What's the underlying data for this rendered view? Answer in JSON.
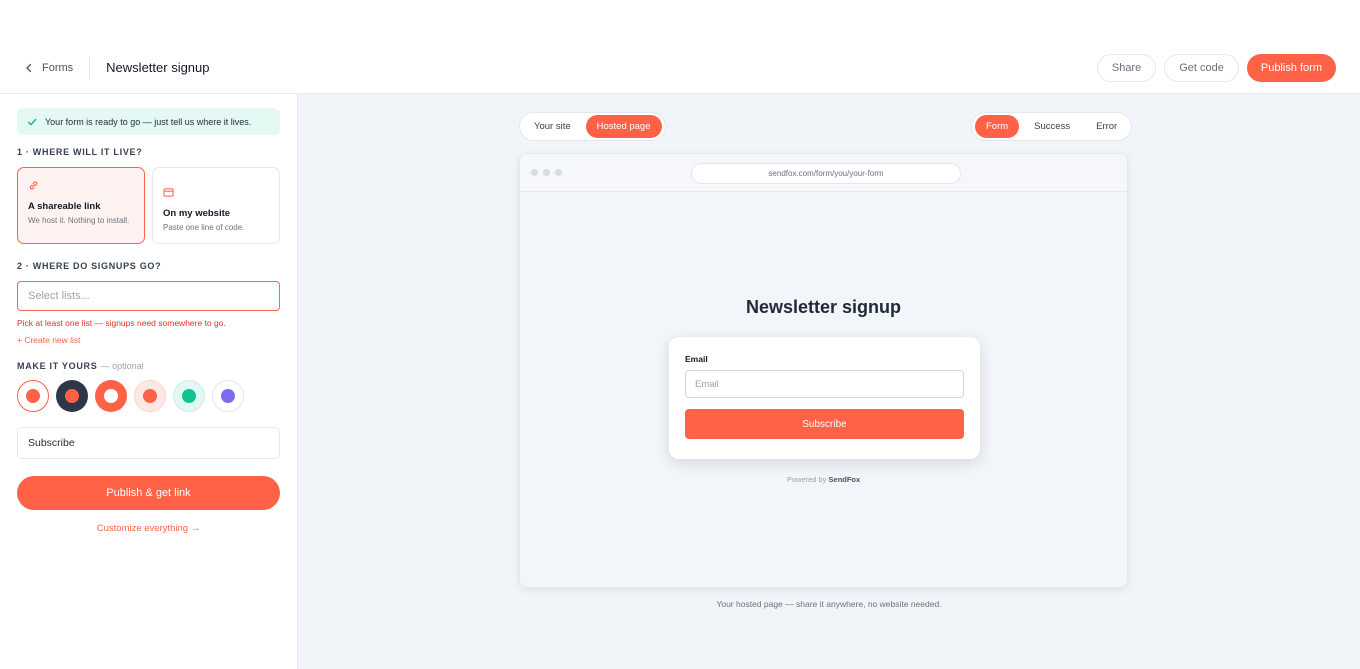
{
  "header": {
    "back_label": "Forms",
    "title": "Newsletter signup",
    "share_label": "Share",
    "get_code_label": "Get code",
    "publish_label": "Publish form"
  },
  "sidebar": {
    "notice": "Your form is ready to go — just tell us where it lives.",
    "section1": "1 · WHERE WILL IT LIVE?",
    "option_link": {
      "title": "A shareable link",
      "subtitle": "We host it. Nothing to install."
    },
    "option_website": {
      "title": "On my website",
      "subtitle": "Paste one line of code."
    },
    "section2": "2 · WHERE DO SIGNUPS GO?",
    "lists_placeholder": "Select lists...",
    "lists_error": "Pick at least one list — signups need somewhere to go.",
    "create_list": "+ Create new list",
    "section3": "MAKE IT YOURS",
    "section3_optional": "— optional",
    "button_text_value": "Subscribe",
    "publish_button": "Publish & get link",
    "customize_link": "Customize everything →"
  },
  "colors": {
    "accent": "#ff6247",
    "swatches": [
      {
        "name": "coral-outline",
        "bg": "#ffffff",
        "dot": "#ff6247",
        "selected": true
      },
      {
        "name": "dark",
        "bg": "#2d3748",
        "dot": "#ff6247"
      },
      {
        "name": "coral-solid",
        "bg": "#ff6247",
        "dot": "#ffffff"
      },
      {
        "name": "coral-soft",
        "bg": "#fde8e4",
        "dot": "#ff6247"
      },
      {
        "name": "green",
        "bg": "#e2f8f2",
        "dot": "#10c28f"
      },
      {
        "name": "purple",
        "bg": "#ffffff",
        "dot": "#7c6cf0"
      }
    ]
  },
  "preview": {
    "view_tabs": [
      {
        "label": "Your site",
        "active": false
      },
      {
        "label": "Hosted page",
        "active": true
      }
    ],
    "state_tabs": [
      {
        "label": "Form",
        "active": true
      },
      {
        "label": "Success",
        "active": false
      },
      {
        "label": "Error",
        "active": false
      }
    ],
    "url": "sendfox.com/form/you/your-form",
    "form_title": "Newsletter signup",
    "email_label": "Email",
    "email_placeholder": "Email",
    "subscribe_label": "Subscribe",
    "powered_prefix": "Powered by",
    "powered_brand": "SendFox",
    "caption": "Your hosted page — share it anywhere, no website needed."
  }
}
